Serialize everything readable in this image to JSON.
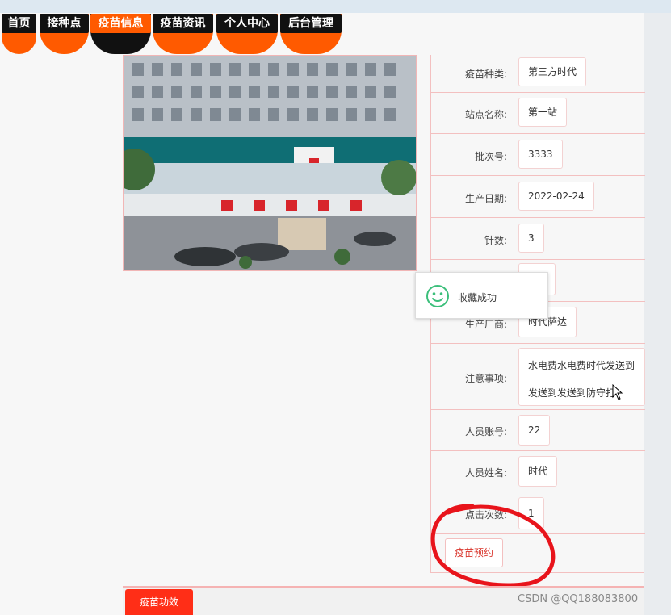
{
  "nav": {
    "items": [
      {
        "label": "首页"
      },
      {
        "label": "接种点"
      },
      {
        "label": "疫苗信息"
      },
      {
        "label": "疫苗资讯"
      },
      {
        "label": "个人中心"
      },
      {
        "label": "后台管理"
      }
    ],
    "active_index": 2
  },
  "details": {
    "rows": [
      {
        "label": "疫苗种类:",
        "value": "第三方时代"
      },
      {
        "label": "站点名称:",
        "value": "第一站"
      },
      {
        "label": "批次号:",
        "value": "3333"
      },
      {
        "label": "生产日期:",
        "value": "2022-02-24"
      },
      {
        "label": "针数:",
        "value": "3"
      },
      {
        "label": "",
        "value": ""
      },
      {
        "label": "生产厂商:",
        "value": "时代萨达"
      },
      {
        "label": "注意事项:",
        "value": "水电费水电费时代发送到发送到发送到防守打"
      },
      {
        "label": "人员账号:",
        "value": "22"
      },
      {
        "label": "人员姓名:",
        "value": "时代"
      },
      {
        "label": "点击次数:",
        "value": "1"
      }
    ],
    "book_button": "疫苗预约"
  },
  "toast": {
    "message": "收藏成功"
  },
  "bottom": {
    "tab": "疫苗功效"
  },
  "watermark": "CSDN @QQ188083800",
  "colors": {
    "accent": "#ff5a00",
    "nav_dark": "#111111",
    "border": "#f3c0c0",
    "button_text": "#d9342b",
    "tab_red": "#ff2e17",
    "toast_icon": "#3cbf7b"
  }
}
